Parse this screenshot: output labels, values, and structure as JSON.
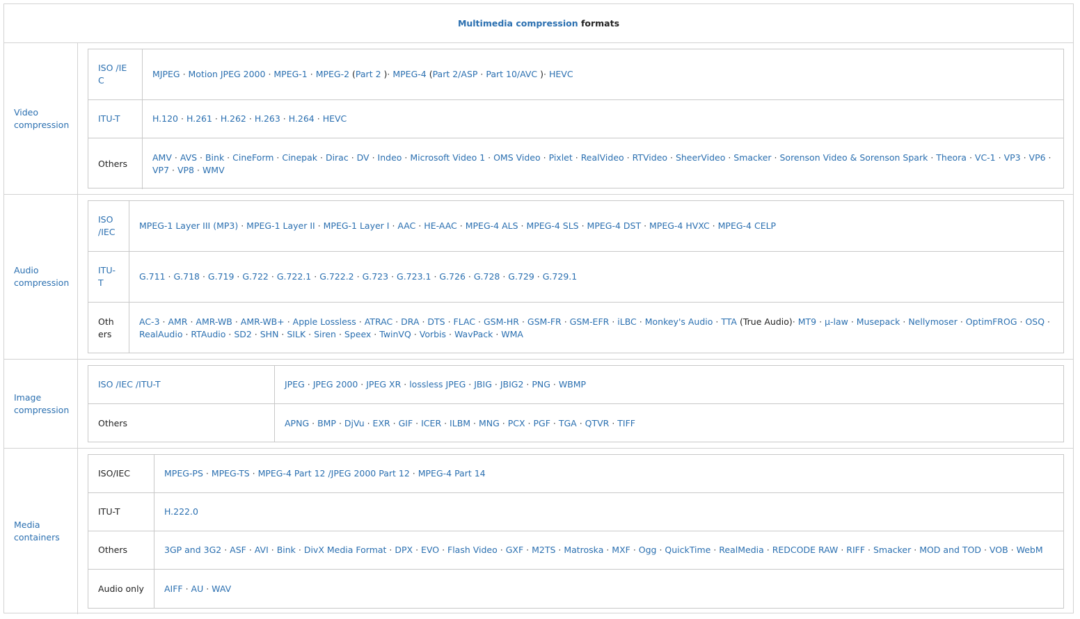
{
  "title": {
    "first": "Multimedia compression",
    "second": "formats"
  },
  "groups": [
    {
      "label": "Video compression",
      "rows": [
        {
          "label": "ISO /IEC",
          "items": [
            {
              "t": "MJPEG"
            },
            {
              "t": "Motion JPEG 2000"
            },
            {
              "t": "MPEG-1"
            },
            {
              "t": "MPEG-2",
              "paren": [
                "Part 2"
              ]
            },
            {
              "t": "MPEG-4",
              "paren": [
                "Part 2/ASP",
                "Part 10/AVC"
              ]
            },
            {
              "t": "HEVC"
            }
          ]
        },
        {
          "label": "ITU-T",
          "items": [
            {
              "t": "H.120"
            },
            {
              "t": "H.261"
            },
            {
              "t": "H.262"
            },
            {
              "t": "H.263"
            },
            {
              "t": "H.264"
            },
            {
              "t": "HEVC"
            }
          ]
        },
        {
          "label": "Others",
          "plain_label": true,
          "items": [
            {
              "t": "AMV"
            },
            {
              "t": "AVS"
            },
            {
              "t": "Bink"
            },
            {
              "t": "CineForm"
            },
            {
              "t": "Cinepak"
            },
            {
              "t": "Dirac"
            },
            {
              "t": "DV"
            },
            {
              "t": "Indeo"
            },
            {
              "t": "Microsoft Video 1"
            },
            {
              "t": "OMS Video"
            },
            {
              "t": "Pixlet"
            },
            {
              "t": "RealVideo"
            },
            {
              "t": "RTVideo"
            },
            {
              "t": "SheerVideo"
            },
            {
              "t": "Smacker"
            },
            {
              "t": "Sorenson Video & Sorenson Spark"
            },
            {
              "t": "Theora"
            },
            {
              "t": "VC-1"
            },
            {
              "t": "VP3"
            },
            {
              "t": "VP6"
            },
            {
              "t": "VP7"
            },
            {
              "t": "VP8"
            },
            {
              "t": "WMV"
            }
          ]
        }
      ]
    },
    {
      "label": "Audio compression",
      "rows": [
        {
          "label": "ISO /IEC",
          "items": [
            {
              "t": "MPEG-1 Layer III (MP3)"
            },
            {
              "t": "MPEG-1 Layer II"
            },
            {
              "t": "MPEG-1 Layer I"
            },
            {
              "t": "AAC"
            },
            {
              "t": "HE-AAC"
            },
            {
              "t": "MPEG-4 ALS"
            },
            {
              "t": "MPEG-4 SLS"
            },
            {
              "t": "MPEG-4 DST"
            },
            {
              "t": "MPEG-4 HVXC"
            },
            {
              "t": "MPEG-4 CELP"
            }
          ]
        },
        {
          "label": "ITU-T",
          "items": [
            {
              "t": "G.711"
            },
            {
              "t": "G.718"
            },
            {
              "t": "G.719"
            },
            {
              "t": "G.722"
            },
            {
              "t": "G.722.1"
            },
            {
              "t": "G.722.2"
            },
            {
              "t": "G.723"
            },
            {
              "t": "G.723.1"
            },
            {
              "t": "G.726"
            },
            {
              "t": "G.728"
            },
            {
              "t": "G.729"
            },
            {
              "t": "G.729.1"
            }
          ]
        },
        {
          "label": "Others",
          "plain_label": true,
          "items": [
            {
              "t": "AC-3"
            },
            {
              "t": "AMR"
            },
            {
              "t": "AMR-WB"
            },
            {
              "t": "AMR-WB+"
            },
            {
              "t": "Apple Lossless"
            },
            {
              "t": "ATRAC"
            },
            {
              "t": "DRA"
            },
            {
              "t": "DTS"
            },
            {
              "t": "FLAC"
            },
            {
              "t": "GSM-HR"
            },
            {
              "t": "GSM-FR"
            },
            {
              "t": "GSM-EFR"
            },
            {
              "t": "iLBC"
            },
            {
              "t": "Monkey's Audio"
            },
            {
              "t": "TTA",
              "note": "(True Audio)"
            },
            {
              "t": "MT9"
            },
            {
              "t": "μ-law"
            },
            {
              "t": "Musepack"
            },
            {
              "t": "Nellymoser"
            },
            {
              "t": "OptimFROG"
            },
            {
              "t": "OSQ"
            },
            {
              "t": "RealAudio"
            },
            {
              "t": "RTAudio"
            },
            {
              "t": "SD2"
            },
            {
              "t": "SHN"
            },
            {
              "t": "SILK"
            },
            {
              "t": "Siren"
            },
            {
              "t": "Speex"
            },
            {
              "t": "TwinVQ"
            },
            {
              "t": "Vorbis"
            },
            {
              "t": "WavPack"
            },
            {
              "t": "WMA"
            }
          ]
        }
      ]
    },
    {
      "label": "Image compression",
      "rows": [
        {
          "label": "ISO /IEC /ITU-T",
          "items": [
            {
              "t": "JPEG"
            },
            {
              "t": "JPEG 2000"
            },
            {
              "t": "JPEG XR"
            },
            {
              "t": "lossless JPEG"
            },
            {
              "t": "JBIG"
            },
            {
              "t": "JBIG2"
            },
            {
              "t": "PNG"
            },
            {
              "t": "WBMP"
            }
          ]
        },
        {
          "label": "Others",
          "plain_label": true,
          "items": [
            {
              "t": "APNG"
            },
            {
              "t": "BMP"
            },
            {
              "t": "DjVu"
            },
            {
              "t": "EXR"
            },
            {
              "t": "GIF"
            },
            {
              "t": "ICER"
            },
            {
              "t": "ILBM"
            },
            {
              "t": "MNG"
            },
            {
              "t": "PCX"
            },
            {
              "t": "PGF"
            },
            {
              "t": "TGA"
            },
            {
              "t": "QTVR"
            },
            {
              "t": "TIFF"
            }
          ]
        }
      ]
    },
    {
      "label": "Media containers",
      "rows": [
        {
          "label": "ISO/IEC",
          "plain_label": true,
          "items": [
            {
              "t": "MPEG-PS"
            },
            {
              "t": "MPEG-TS"
            },
            {
              "t": "MPEG-4 Part 12 /JPEG 2000 Part 12"
            },
            {
              "t": "MPEG-4 Part 14"
            }
          ]
        },
        {
          "label": "ITU-T",
          "plain_label": true,
          "items": [
            {
              "t": "H.222.0"
            }
          ]
        },
        {
          "label": "Others",
          "plain_label": true,
          "items": [
            {
              "t": "3GP and 3G2"
            },
            {
              "t": "ASF"
            },
            {
              "t": "AVI"
            },
            {
              "t": "Bink"
            },
            {
              "t": "DivX Media Format"
            },
            {
              "t": "DPX"
            },
            {
              "t": "EVO"
            },
            {
              "t": "Flash Video"
            },
            {
              "t": "GXF"
            },
            {
              "t": "M2TS"
            },
            {
              "t": "Matroska"
            },
            {
              "t": "MXF"
            },
            {
              "t": "Ogg"
            },
            {
              "t": "QuickTime"
            },
            {
              "t": "RealMedia"
            },
            {
              "t": "REDCODE RAW"
            },
            {
              "t": "RIFF"
            },
            {
              "t": "Smacker"
            },
            {
              "t": "MOD and TOD"
            },
            {
              "t": "VOB"
            },
            {
              "t": "WebM"
            }
          ]
        },
        {
          "label": "Audio only",
          "plain_label": true,
          "items": [
            {
              "t": "AIFF"
            },
            {
              "t": "AU"
            },
            {
              "t": "WAV"
            }
          ]
        }
      ]
    }
  ]
}
